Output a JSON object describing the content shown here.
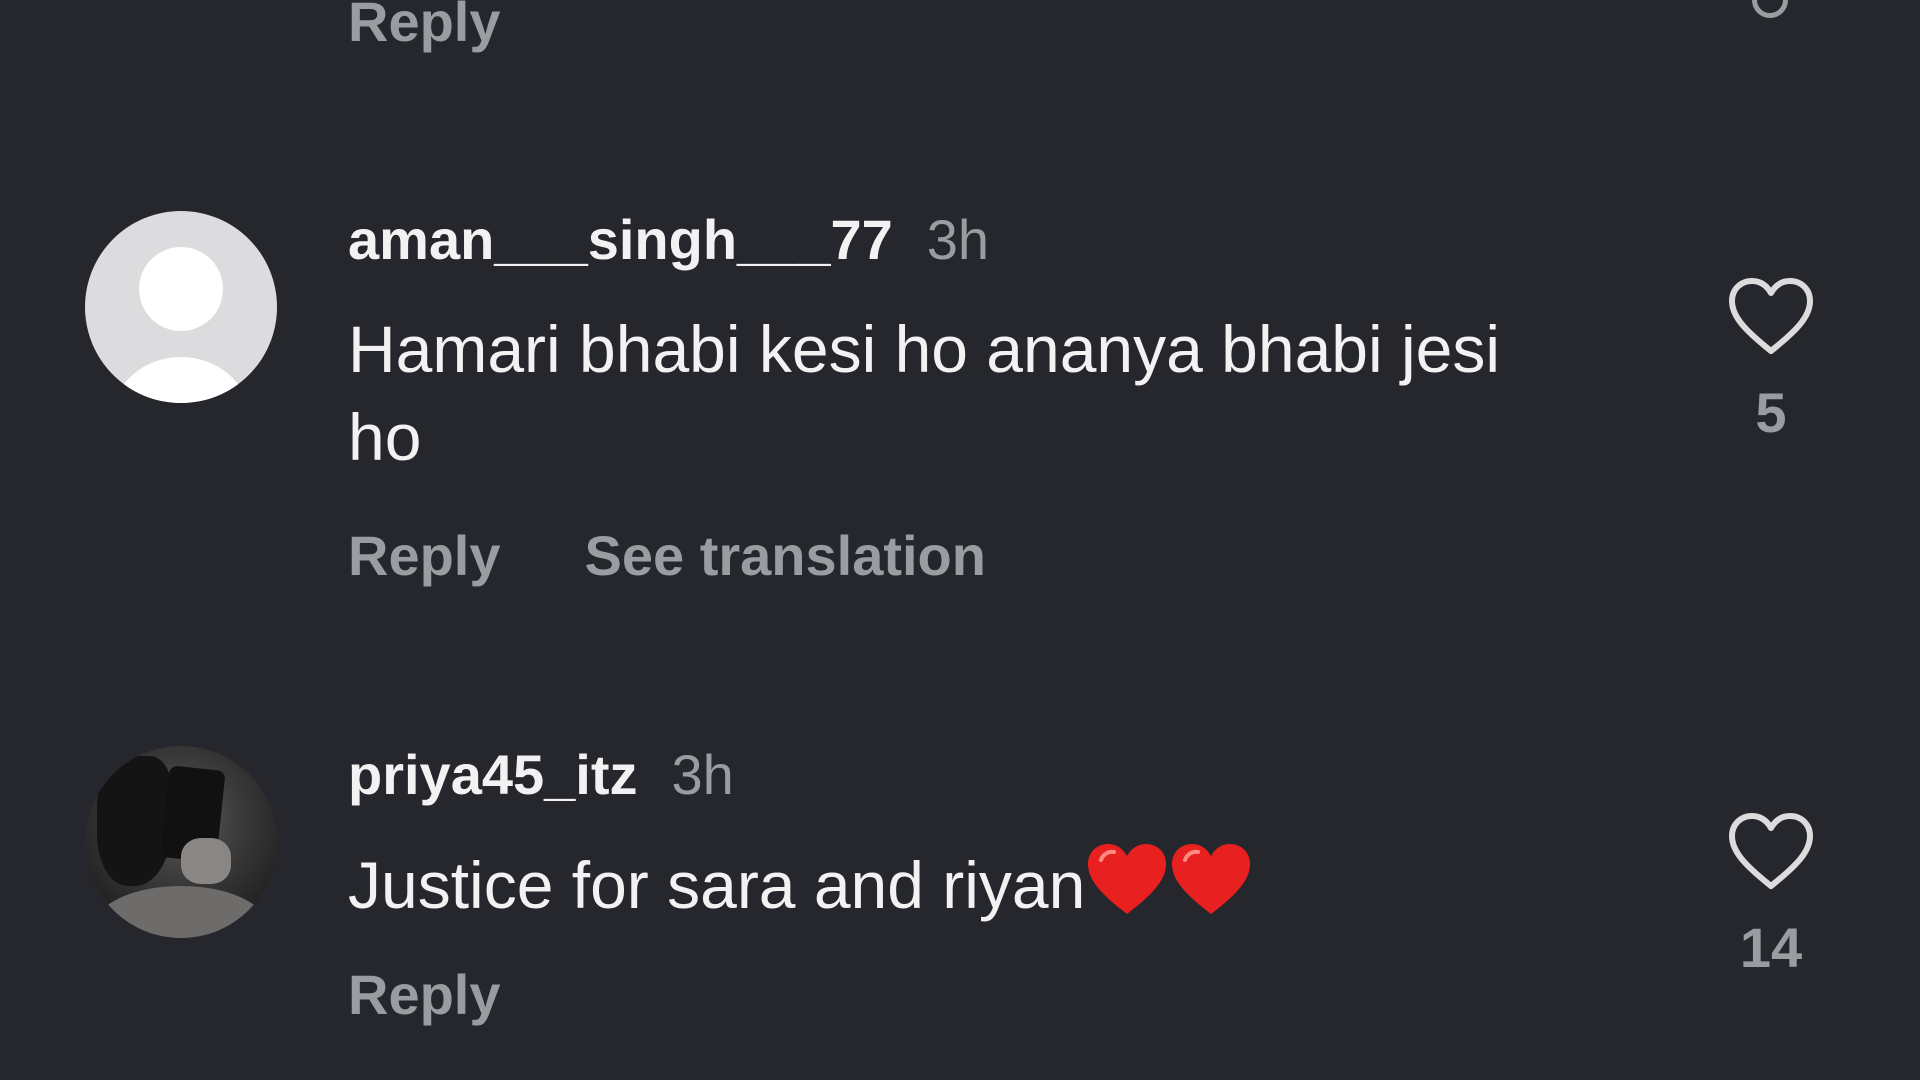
{
  "top_comment": {
    "reply_label": "Reply"
  },
  "comments": [
    {
      "username": "aman___singh___77",
      "time": "3h",
      "text": "Hamari bhabi kesi ho ananya bhabi jesi ho",
      "reply_label": "Reply",
      "translation_label": "See translation",
      "like_count": "5",
      "avatar": "default-avatar-icon"
    },
    {
      "username": "priya45_itz",
      "time": "3h",
      "text": "Justice for sara and riyan",
      "emoji": [
        "red-heart-emoji",
        "red-heart-emoji"
      ],
      "reply_label": "Reply",
      "like_count": "14",
      "avatar": "profile-photo"
    }
  ],
  "icons": {
    "like": "heart-outline-icon"
  },
  "colors": {
    "background": "#25272d",
    "primary_text": "#f2f2f2",
    "secondary_text": "#9a9ca1",
    "emoji_heart": "#e8201f"
  }
}
